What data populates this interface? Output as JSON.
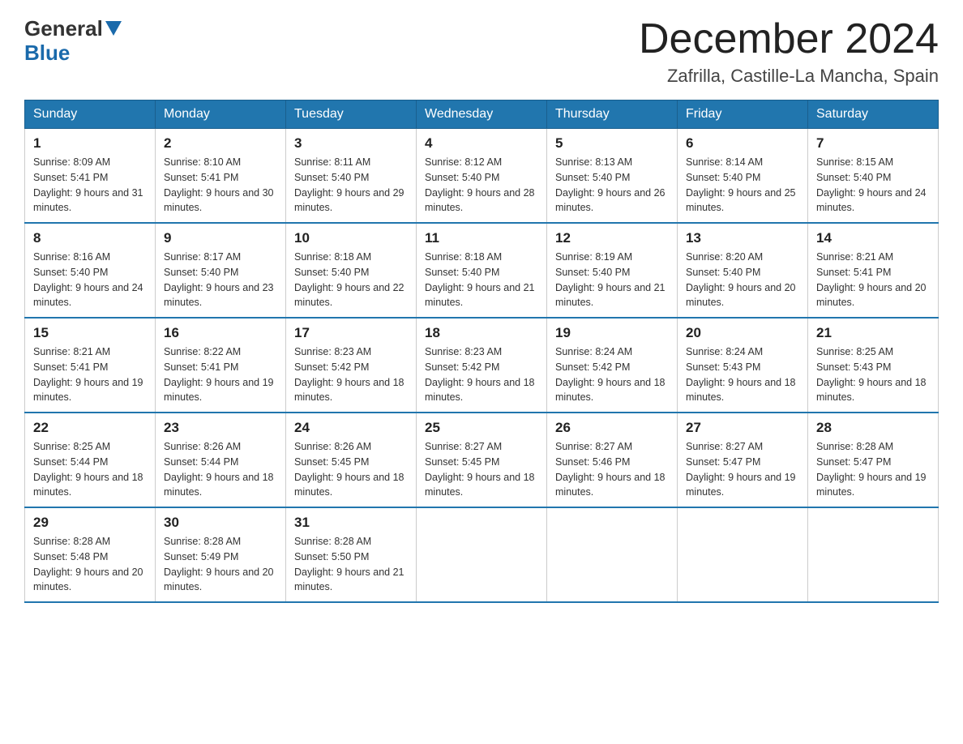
{
  "header": {
    "logo_general": "General",
    "logo_blue": "Blue",
    "month_title": "December 2024",
    "location": "Zafrilla, Castille-La Mancha, Spain"
  },
  "days_of_week": [
    "Sunday",
    "Monday",
    "Tuesday",
    "Wednesday",
    "Thursday",
    "Friday",
    "Saturday"
  ],
  "weeks": [
    [
      {
        "day": "1",
        "sunrise": "Sunrise: 8:09 AM",
        "sunset": "Sunset: 5:41 PM",
        "daylight": "Daylight: 9 hours and 31 minutes."
      },
      {
        "day": "2",
        "sunrise": "Sunrise: 8:10 AM",
        "sunset": "Sunset: 5:41 PM",
        "daylight": "Daylight: 9 hours and 30 minutes."
      },
      {
        "day": "3",
        "sunrise": "Sunrise: 8:11 AM",
        "sunset": "Sunset: 5:40 PM",
        "daylight": "Daylight: 9 hours and 29 minutes."
      },
      {
        "day": "4",
        "sunrise": "Sunrise: 8:12 AM",
        "sunset": "Sunset: 5:40 PM",
        "daylight": "Daylight: 9 hours and 28 minutes."
      },
      {
        "day": "5",
        "sunrise": "Sunrise: 8:13 AM",
        "sunset": "Sunset: 5:40 PM",
        "daylight": "Daylight: 9 hours and 26 minutes."
      },
      {
        "day": "6",
        "sunrise": "Sunrise: 8:14 AM",
        "sunset": "Sunset: 5:40 PM",
        "daylight": "Daylight: 9 hours and 25 minutes."
      },
      {
        "day": "7",
        "sunrise": "Sunrise: 8:15 AM",
        "sunset": "Sunset: 5:40 PM",
        "daylight": "Daylight: 9 hours and 24 minutes."
      }
    ],
    [
      {
        "day": "8",
        "sunrise": "Sunrise: 8:16 AM",
        "sunset": "Sunset: 5:40 PM",
        "daylight": "Daylight: 9 hours and 24 minutes."
      },
      {
        "day": "9",
        "sunrise": "Sunrise: 8:17 AM",
        "sunset": "Sunset: 5:40 PM",
        "daylight": "Daylight: 9 hours and 23 minutes."
      },
      {
        "day": "10",
        "sunrise": "Sunrise: 8:18 AM",
        "sunset": "Sunset: 5:40 PM",
        "daylight": "Daylight: 9 hours and 22 minutes."
      },
      {
        "day": "11",
        "sunrise": "Sunrise: 8:18 AM",
        "sunset": "Sunset: 5:40 PM",
        "daylight": "Daylight: 9 hours and 21 minutes."
      },
      {
        "day": "12",
        "sunrise": "Sunrise: 8:19 AM",
        "sunset": "Sunset: 5:40 PM",
        "daylight": "Daylight: 9 hours and 21 minutes."
      },
      {
        "day": "13",
        "sunrise": "Sunrise: 8:20 AM",
        "sunset": "Sunset: 5:40 PM",
        "daylight": "Daylight: 9 hours and 20 minutes."
      },
      {
        "day": "14",
        "sunrise": "Sunrise: 8:21 AM",
        "sunset": "Sunset: 5:41 PM",
        "daylight": "Daylight: 9 hours and 20 minutes."
      }
    ],
    [
      {
        "day": "15",
        "sunrise": "Sunrise: 8:21 AM",
        "sunset": "Sunset: 5:41 PM",
        "daylight": "Daylight: 9 hours and 19 minutes."
      },
      {
        "day": "16",
        "sunrise": "Sunrise: 8:22 AM",
        "sunset": "Sunset: 5:41 PM",
        "daylight": "Daylight: 9 hours and 19 minutes."
      },
      {
        "day": "17",
        "sunrise": "Sunrise: 8:23 AM",
        "sunset": "Sunset: 5:42 PM",
        "daylight": "Daylight: 9 hours and 18 minutes."
      },
      {
        "day": "18",
        "sunrise": "Sunrise: 8:23 AM",
        "sunset": "Sunset: 5:42 PM",
        "daylight": "Daylight: 9 hours and 18 minutes."
      },
      {
        "day": "19",
        "sunrise": "Sunrise: 8:24 AM",
        "sunset": "Sunset: 5:42 PM",
        "daylight": "Daylight: 9 hours and 18 minutes."
      },
      {
        "day": "20",
        "sunrise": "Sunrise: 8:24 AM",
        "sunset": "Sunset: 5:43 PM",
        "daylight": "Daylight: 9 hours and 18 minutes."
      },
      {
        "day": "21",
        "sunrise": "Sunrise: 8:25 AM",
        "sunset": "Sunset: 5:43 PM",
        "daylight": "Daylight: 9 hours and 18 minutes."
      }
    ],
    [
      {
        "day": "22",
        "sunrise": "Sunrise: 8:25 AM",
        "sunset": "Sunset: 5:44 PM",
        "daylight": "Daylight: 9 hours and 18 minutes."
      },
      {
        "day": "23",
        "sunrise": "Sunrise: 8:26 AM",
        "sunset": "Sunset: 5:44 PM",
        "daylight": "Daylight: 9 hours and 18 minutes."
      },
      {
        "day": "24",
        "sunrise": "Sunrise: 8:26 AM",
        "sunset": "Sunset: 5:45 PM",
        "daylight": "Daylight: 9 hours and 18 minutes."
      },
      {
        "day": "25",
        "sunrise": "Sunrise: 8:27 AM",
        "sunset": "Sunset: 5:45 PM",
        "daylight": "Daylight: 9 hours and 18 minutes."
      },
      {
        "day": "26",
        "sunrise": "Sunrise: 8:27 AM",
        "sunset": "Sunset: 5:46 PM",
        "daylight": "Daylight: 9 hours and 18 minutes."
      },
      {
        "day": "27",
        "sunrise": "Sunrise: 8:27 AM",
        "sunset": "Sunset: 5:47 PM",
        "daylight": "Daylight: 9 hours and 19 minutes."
      },
      {
        "day": "28",
        "sunrise": "Sunrise: 8:28 AM",
        "sunset": "Sunset: 5:47 PM",
        "daylight": "Daylight: 9 hours and 19 minutes."
      }
    ],
    [
      {
        "day": "29",
        "sunrise": "Sunrise: 8:28 AM",
        "sunset": "Sunset: 5:48 PM",
        "daylight": "Daylight: 9 hours and 20 minutes."
      },
      {
        "day": "30",
        "sunrise": "Sunrise: 8:28 AM",
        "sunset": "Sunset: 5:49 PM",
        "daylight": "Daylight: 9 hours and 20 minutes."
      },
      {
        "day": "31",
        "sunrise": "Sunrise: 8:28 AM",
        "sunset": "Sunset: 5:50 PM",
        "daylight": "Daylight: 9 hours and 21 minutes."
      },
      null,
      null,
      null,
      null
    ]
  ]
}
